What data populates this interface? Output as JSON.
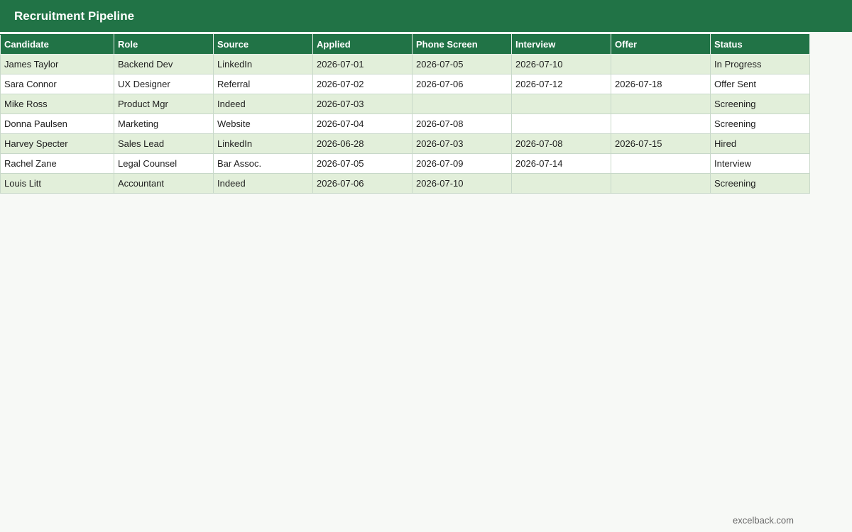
{
  "header": {
    "title": "Recruitment Pipeline"
  },
  "table": {
    "columns": [
      "Candidate",
      "Role",
      "Source",
      "Applied",
      "Phone Screen",
      "Interview",
      "Offer",
      "Status"
    ],
    "rows": [
      [
        "James Taylor",
        "Backend Dev",
        "LinkedIn",
        "2026-07-01",
        "2026-07-05",
        "2026-07-10",
        "",
        "In Progress"
      ],
      [
        "Sara Connor",
        "UX Designer",
        "Referral",
        "2026-07-02",
        "2026-07-06",
        "2026-07-12",
        "2026-07-18",
        "Offer Sent"
      ],
      [
        "Mike Ross",
        "Product Mgr",
        "Indeed",
        "2026-07-03",
        "",
        "",
        "",
        "Screening"
      ],
      [
        "Donna Paulsen",
        "Marketing",
        "Website",
        "2026-07-04",
        "2026-07-08",
        "",
        "",
        "Screening"
      ],
      [
        "Harvey Specter",
        "Sales Lead",
        "LinkedIn",
        "2026-06-28",
        "2026-07-03",
        "2026-07-08",
        "2026-07-15",
        "Hired"
      ],
      [
        "Rachel Zane",
        "Legal Counsel",
        "Bar Assoc.",
        "2026-07-05",
        "2026-07-09",
        "2026-07-14",
        "",
        "Interview"
      ],
      [
        "Louis Litt",
        "Accountant",
        "Indeed",
        "2026-07-06",
        "2026-07-10",
        "",
        "",
        "Screening"
      ]
    ]
  },
  "footer": {
    "text": "excelback.com"
  },
  "colors": {
    "header_green": "#217346",
    "band_green": "#e2efda",
    "page_background": "#f7f9f6"
  }
}
